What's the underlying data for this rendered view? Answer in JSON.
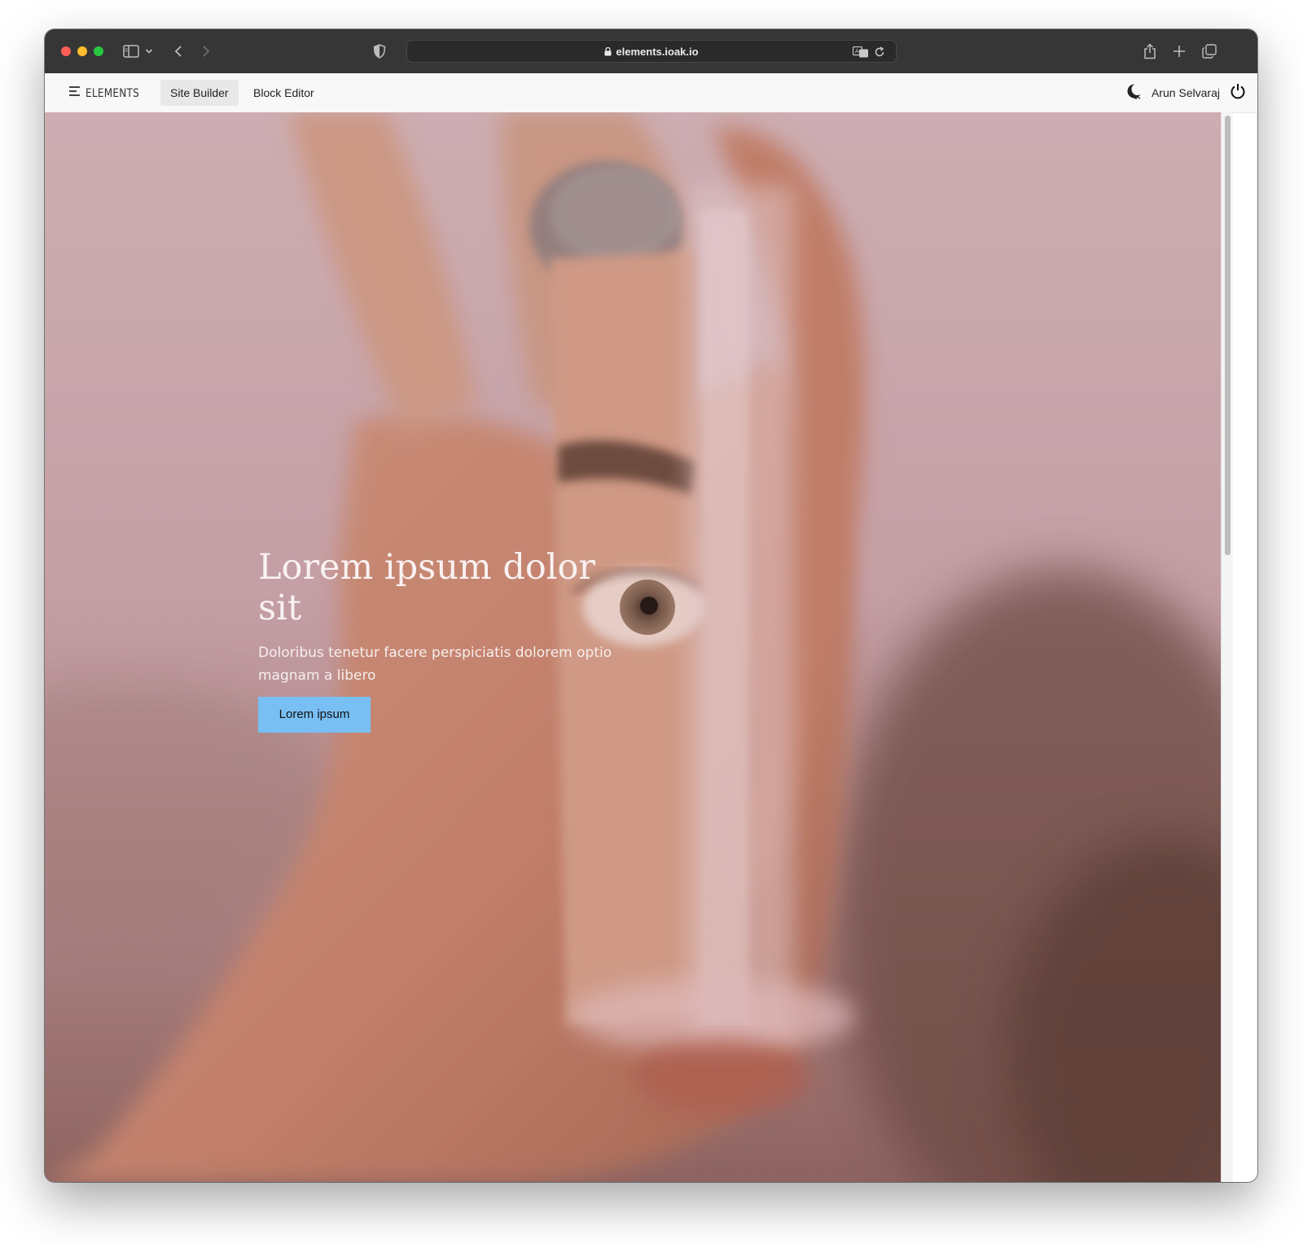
{
  "browser": {
    "url": "elements.ioak.io"
  },
  "app": {
    "brand": "ELEMENTS",
    "nav": [
      {
        "label": "Site Builder",
        "active": true
      },
      {
        "label": "Block Editor",
        "active": false
      }
    ],
    "user_name": "Arun Selvaraj"
  },
  "hero": {
    "title": "Lorem ipsum dolor sit",
    "subtitle": "Doloribus tenetur facere perspiciatis dolorem optio magnam a libero",
    "cta_label": "Lorem ipsum",
    "cta_color": "#78bff4"
  },
  "icons": [
    "sidebar-icon",
    "chevron-down-icon",
    "back-icon",
    "forward-icon",
    "shield-icon",
    "lock-icon",
    "translate-icon",
    "reload-icon",
    "share-icon",
    "new-tab-icon",
    "tabs-overview-icon",
    "menu-icon",
    "dark-mode-icon",
    "power-icon"
  ]
}
